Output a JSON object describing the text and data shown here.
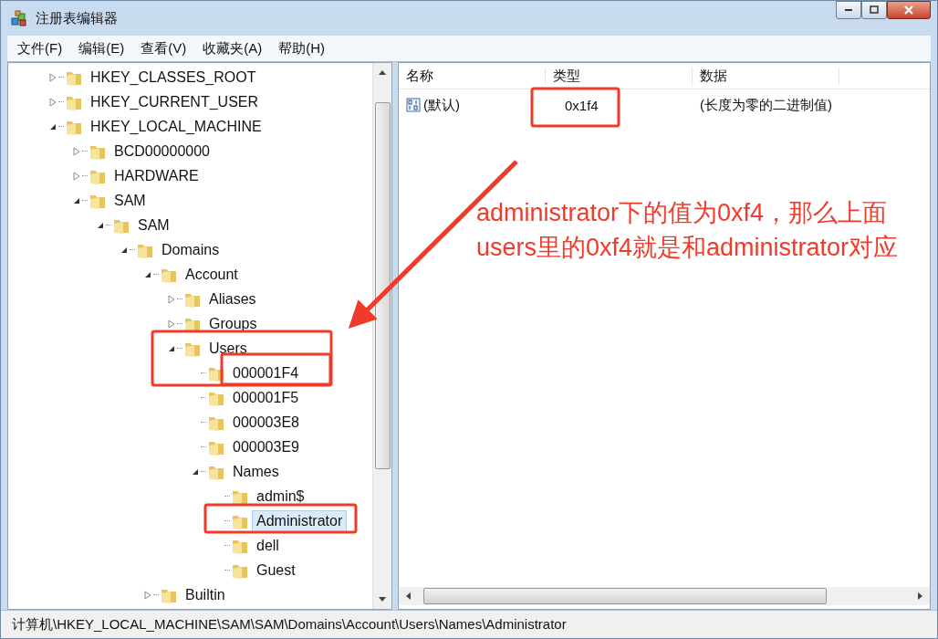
{
  "window": {
    "title": "注册表编辑器"
  },
  "menu": [
    "文件(F)",
    "编辑(E)",
    "查看(V)",
    "收藏夹(A)",
    "帮助(H)"
  ],
  "tree": [
    {
      "label": "HKEY_CLASSES_ROOT",
      "expanded": false,
      "selected": false
    },
    {
      "label": "HKEY_CURRENT_USER",
      "expanded": false,
      "selected": false
    },
    {
      "label": "HKEY_LOCAL_MACHINE",
      "expanded": true,
      "selected": false,
      "children": [
        {
          "label": "BCD00000000",
          "expanded": false,
          "selected": false
        },
        {
          "label": "HARDWARE",
          "expanded": false,
          "selected": false
        },
        {
          "label": "SAM",
          "expanded": true,
          "selected": false,
          "children": [
            {
              "label": "SAM",
              "expanded": true,
              "selected": false,
              "children": [
                {
                  "label": "Domains",
                  "expanded": true,
                  "selected": false,
                  "children": [
                    {
                      "label": "Account",
                      "expanded": true,
                      "selected": false,
                      "children": [
                        {
                          "label": "Aliases",
                          "expanded": false,
                          "selected": false
                        },
                        {
                          "label": "Groups",
                          "expanded": false,
                          "selected": false
                        },
                        {
                          "label": "Users",
                          "expanded": true,
                          "selected": false,
                          "children": [
                            {
                              "label": "000001F4",
                              "selected": false
                            },
                            {
                              "label": "000001F5",
                              "selected": false
                            },
                            {
                              "label": "000003E8",
                              "selected": false
                            },
                            {
                              "label": "000003E9",
                              "selected": false
                            },
                            {
                              "label": "Names",
                              "expanded": true,
                              "selected": false,
                              "children": [
                                {
                                  "label": "admin$",
                                  "selected": false
                                },
                                {
                                  "label": "Administrator",
                                  "selected": true
                                },
                                {
                                  "label": "dell",
                                  "selected": false
                                },
                                {
                                  "label": "Guest",
                                  "selected": false
                                }
                              ]
                            }
                          ]
                        }
                      ]
                    },
                    {
                      "label": "Builtin",
                      "expanded": false,
                      "selected": false
                    }
                  ]
                }
              ]
            }
          ]
        }
      ]
    }
  ],
  "table": {
    "columns": [
      "名称",
      "类型",
      "数据"
    ],
    "rows": [
      {
        "name": "(默认)",
        "type": "0x1f4",
        "data": "(长度为零的二进制值)"
      }
    ]
  },
  "annotation": "administrator下的值为0xf4，那么上面users里的0xf4就是和administrator对应",
  "status_bar": "计算机\\HKEY_LOCAL_MACHINE\\SAM\\SAM\\Domains\\Account\\Users\\Names\\Administrator"
}
